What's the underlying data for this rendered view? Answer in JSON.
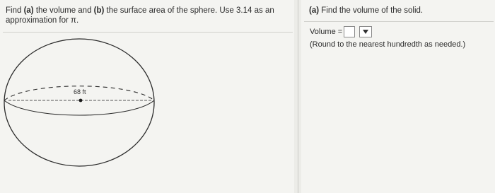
{
  "question": {
    "part1": "Find ",
    "a_label": "(a)",
    "part2": " the volume and ",
    "b_label": "(b)",
    "part3": " the surface area of the sphere. Use 3.14 as an approximation for π."
  },
  "figure": {
    "dimension_label": "68 ft"
  },
  "part_a": {
    "label": "(a)",
    "prompt": "Find the volume of the solid.",
    "answer_label": "Volume =",
    "answer_value": "",
    "note": "(Round to the nearest hundredth as needed.)"
  },
  "colors": {
    "background": "#f4f4f1",
    "line": "#2a2a2a"
  }
}
